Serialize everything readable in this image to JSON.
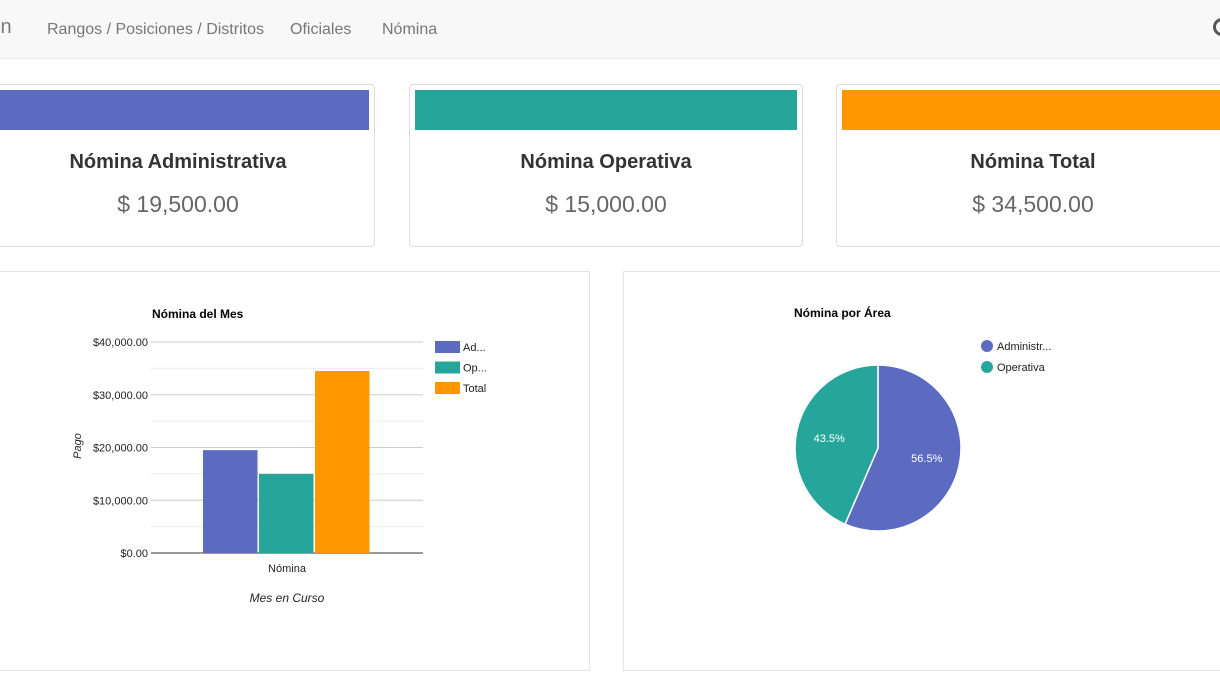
{
  "navbar": {
    "brand_partial": "in",
    "links": [
      {
        "label": "Rangos / Posiciones / Distritos"
      },
      {
        "label": "Oficiales"
      },
      {
        "label": "Nómina"
      }
    ]
  },
  "cards": [
    {
      "title": "Nómina Administrativa",
      "value": "$ 19,500.00",
      "color": "#5c6bc0"
    },
    {
      "title": "Nómina Operativa",
      "value": "$ 15,000.00",
      "color": "#26a69a"
    },
    {
      "title": "Nómina Total",
      "value": "$ 34,500.00",
      "color": "#ff9800"
    }
  ],
  "chart_data": [
    {
      "type": "bar",
      "title": "Nómina del Mes",
      "xlabel": "Mes en Curso",
      "ylabel": "Pago",
      "categories": [
        "Nómina"
      ],
      "ylim": [
        0,
        40000
      ],
      "yticks": [
        {
          "value": 0,
          "label": "$0.00"
        },
        {
          "value": 10000,
          "label": "$10,000.00"
        },
        {
          "value": 20000,
          "label": "$20,000.00"
        },
        {
          "value": 30000,
          "label": "$30,000.00"
        },
        {
          "value": 40000,
          "label": "$40,000.00"
        }
      ],
      "series": [
        {
          "name": "Ad...",
          "values": [
            19500
          ],
          "color": "#5c6bc0"
        },
        {
          "name": "Op...",
          "values": [
            15000
          ],
          "color": "#26a69a"
        },
        {
          "name": "Total",
          "values": [
            34500
          ],
          "color": "#ff9800"
        }
      ],
      "grid": true,
      "legend": "right"
    },
    {
      "type": "pie",
      "title": "Nómina por Área",
      "slices": [
        {
          "name": "Administr...",
          "value": 56.5,
          "label": "56.5%",
          "color": "#5c6bc0"
        },
        {
          "name": "Operativa",
          "value": 43.5,
          "label": "43.5%",
          "color": "#26a69a"
        }
      ],
      "legend": "right"
    }
  ]
}
